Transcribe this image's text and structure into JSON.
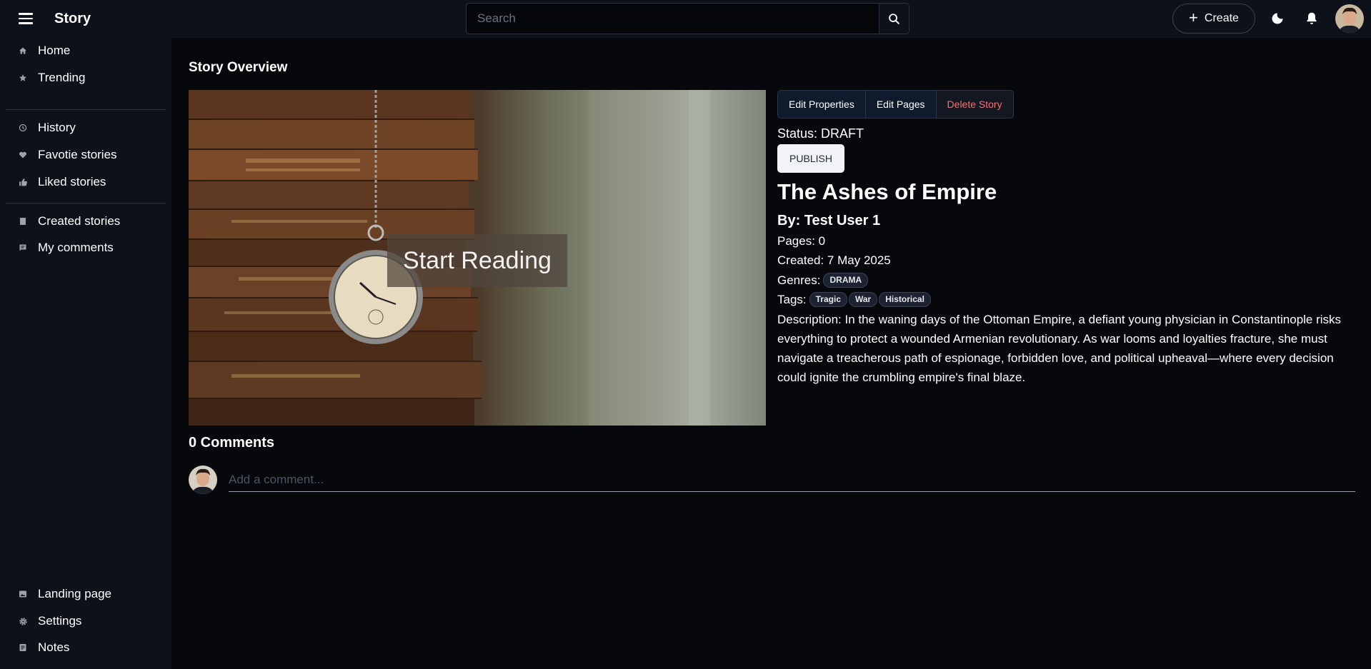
{
  "header": {
    "app_title": "Story",
    "search_placeholder": "Search",
    "create_label": "Create"
  },
  "sidebar": {
    "primary": [
      {
        "label": "Home",
        "icon": "home-icon"
      },
      {
        "label": "Trending",
        "icon": "star-icon"
      }
    ],
    "library": [
      {
        "label": "History",
        "icon": "history-icon"
      },
      {
        "label": "Favotie stories",
        "icon": "heart-icon"
      },
      {
        "label": "Liked stories",
        "icon": "thumbs-up-icon"
      }
    ],
    "mine": [
      {
        "label": "Created stories",
        "icon": "book-icon"
      },
      {
        "label": "My comments",
        "icon": "comment-icon"
      }
    ],
    "bottom": [
      {
        "label": "Landing page",
        "icon": "image-icon"
      },
      {
        "label": "Settings",
        "icon": "gear-icon"
      },
      {
        "label": "Notes",
        "icon": "note-icon"
      }
    ]
  },
  "main": {
    "section_title": "Story Overview",
    "start_reading": "Start Reading",
    "actions": {
      "edit_properties": "Edit Properties",
      "edit_pages": "Edit Pages",
      "delete_story": "Delete Story"
    },
    "status_text": "Status: DRAFT",
    "publish_label": "PUBLISH",
    "title": "The Ashes of Empire",
    "author": "By: Test User 1",
    "pages": "Pages: 0",
    "created": "Created: 7 May 2025",
    "genres_label": "Genres:",
    "genres": [
      "DRAMA"
    ],
    "tags_label": "Tags:",
    "tags": [
      "Tragic",
      "War",
      "Historical"
    ],
    "description": "Description: In the waning days of the Ottoman Empire, a defiant young physician in Constantinople risks everything to protect a wounded Armenian revolutionary. As war looms and loyalties fracture, she must navigate a treacherous path of espionage, forbidden love, and political upheaval—where every decision could ignite the crumbling empire's final blaze."
  },
  "comments": {
    "title": "0 Comments",
    "placeholder": "Add a comment..."
  },
  "colors": {
    "background": "#06080c",
    "panel": "#0c111a",
    "delete": "#f87171",
    "publish_bg": "#f1f3f7"
  }
}
